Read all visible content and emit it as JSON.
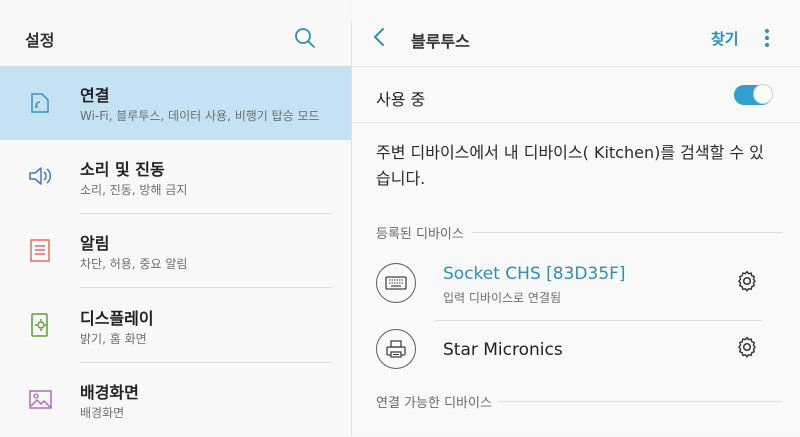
{
  "settings": {
    "title": "설정",
    "items": [
      {
        "label": "연결",
        "sub": "Wi-Fi, 블루투스, 데이터 사용, 비행기 탑승 모드",
        "icon": "connections-icon"
      },
      {
        "label": "소리 및 진동",
        "sub": "소리, 진동, 방해 금지",
        "icon": "speaker-icon"
      },
      {
        "label": "알림",
        "sub": "차단, 허용, 중요 알림",
        "icon": "notification-icon"
      },
      {
        "label": "디스플레이",
        "sub": "밝기, 홈 화면",
        "icon": "display-icon"
      },
      {
        "label": "배경화면",
        "sub": "배경화면",
        "icon": "wallpaper-icon"
      }
    ]
  },
  "bluetooth": {
    "title": "블루투스",
    "find_label": "찾기",
    "toggle_label": "사용 중",
    "toggle_on": true,
    "description": "주변 디바이스에서 내 디바이스(      Kitchen)를 검색할 수 있습니다.",
    "registered_header": "등록된 디바이스",
    "available_header": "연결 가능한 디바이스",
    "devices": [
      {
        "name": "Socket CHS [83D35F]",
        "status": "입력 디바이스로 연결됨",
        "icon": "keyboard-icon"
      },
      {
        "name": "Star Micronics",
        "status": "",
        "icon": "printer-icon"
      }
    ]
  },
  "colors": {
    "accent": "#2c8fb8",
    "active_item_bg": "#c3e3f4",
    "toggle_on": "#2f9fd0"
  }
}
